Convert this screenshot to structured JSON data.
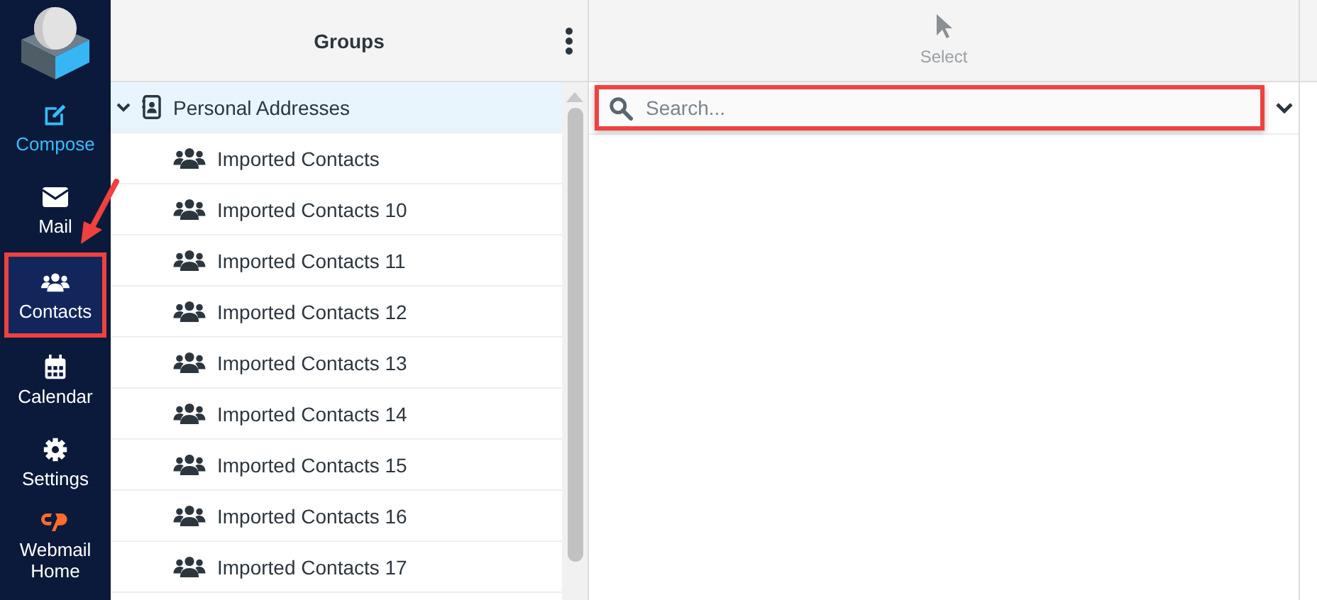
{
  "nav": [
    {
      "kind": "compose",
      "label": "Compose",
      "selected": false,
      "highlighted": false
    },
    {
      "kind": "mail",
      "label": "Mail",
      "selected": false,
      "highlighted": false
    },
    {
      "kind": "contacts",
      "label": "Contacts",
      "selected": true,
      "highlighted": true
    },
    {
      "kind": "calendar",
      "label": "Calendar",
      "selected": false,
      "highlighted": false
    },
    {
      "kind": "settings",
      "label": "Settings",
      "selected": false,
      "highlighted": false
    },
    {
      "kind": "cpanel",
      "label": "Webmail Home",
      "selected": false,
      "highlighted": false
    }
  ],
  "groups": {
    "title": "Groups",
    "items": [
      {
        "label": "Personal Addresses",
        "expanded": true,
        "selected": true,
        "children": [
          {
            "label": "Imported Contacts",
            "selected": false
          },
          {
            "label": "Imported Contacts 10",
            "selected": false
          },
          {
            "label": "Imported Contacts 11",
            "selected": false
          },
          {
            "label": "Imported Contacts 12",
            "selected": false
          },
          {
            "label": "Imported Contacts 13",
            "selected": false
          },
          {
            "label": "Imported Contacts 14",
            "selected": false
          },
          {
            "label": "Imported Contacts 15",
            "selected": false
          },
          {
            "label": "Imported Contacts 16",
            "selected": false
          },
          {
            "label": "Imported Contacts 17",
            "selected": false
          }
        ]
      }
    ]
  },
  "contacts": {
    "toolbar": [
      {
        "label": "Select",
        "disabled": true
      }
    ],
    "search": {
      "placeholder": "Search...",
      "highlighted": true
    }
  }
}
